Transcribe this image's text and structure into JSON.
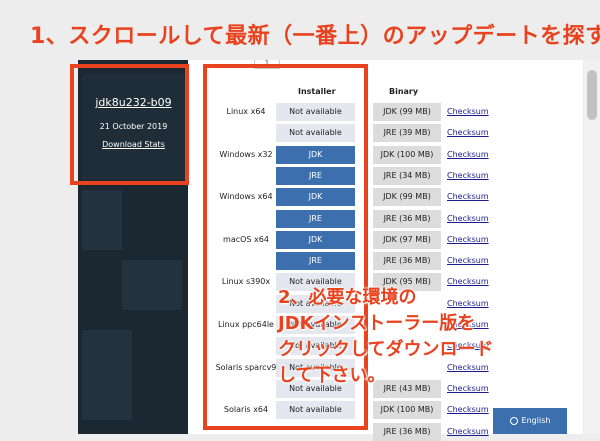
{
  "banner": "1、スクロールして最新（一番上）のアップデートを探す。",
  "release": {
    "version": "jdk8u232-b09",
    "date": "21 October 2019",
    "stats_link": "Download Stats"
  },
  "tab_indicator": "1",
  "table": {
    "headers": {
      "installer": "Installer",
      "binary": "Binary"
    },
    "rows": [
      {
        "os": "Linux x64",
        "installer": "Not available",
        "binary": "JDK (99 MB)",
        "checksum": "Checksum"
      },
      {
        "os": "",
        "installer": "Not available",
        "binary": "JRE (39 MB)",
        "checksum": "Checksum"
      },
      {
        "os": "Windows x32",
        "installer": "JDK",
        "binary": "JDK (100 MB)",
        "checksum": "Checksum"
      },
      {
        "os": "",
        "installer": "JRE",
        "binary": "JRE (34 MB)",
        "checksum": "Checksum"
      },
      {
        "os": "Windows x64",
        "installer": "JDK",
        "binary": "JDK (99 MB)",
        "checksum": "Checksum"
      },
      {
        "os": "",
        "installer": "JRE",
        "binary": "JRE (36 MB)",
        "checksum": "Checksum"
      },
      {
        "os": "macOS x64",
        "installer": "JDK",
        "binary": "JDK (97 MB)",
        "checksum": "Checksum"
      },
      {
        "os": "",
        "installer": "JRE",
        "binary": "JRE (36 MB)",
        "checksum": "Checksum"
      },
      {
        "os": "Linux s390x",
        "installer": "Not available",
        "binary": "JDK (95 MB)",
        "checksum": "Checksum"
      },
      {
        "os": "",
        "installer": "Not available",
        "binary": "",
        "checksum": "Checksum"
      },
      {
        "os": "Linux ppc64le",
        "installer": "Not available",
        "binary": "",
        "checksum": "Checksum"
      },
      {
        "os": "",
        "installer": "Not available",
        "binary": "",
        "checksum": "Checksum"
      },
      {
        "os": "Solaris sparcv9",
        "installer": "Not available",
        "binary": "",
        "checksum": "Checksum"
      },
      {
        "os": "",
        "installer": "Not available",
        "binary": "JRE (43 MB)",
        "checksum": "Checksum"
      },
      {
        "os": "Solaris x64",
        "installer": "Not available",
        "binary": "JDK (100 MB)",
        "checksum": "Checksum"
      },
      {
        "os": "",
        "installer": "",
        "binary": "JRE (36 MB)",
        "checksum": "Checksum"
      }
    ]
  },
  "note": "2、必要な環境の\nJDKインストーラー版を\nクリックしてダウンロード\nして下さい。",
  "language_button": "English",
  "colors": {
    "accent": "#e8421f",
    "button_blue": "#3c6fae",
    "sidebar": "#1b2832"
  }
}
